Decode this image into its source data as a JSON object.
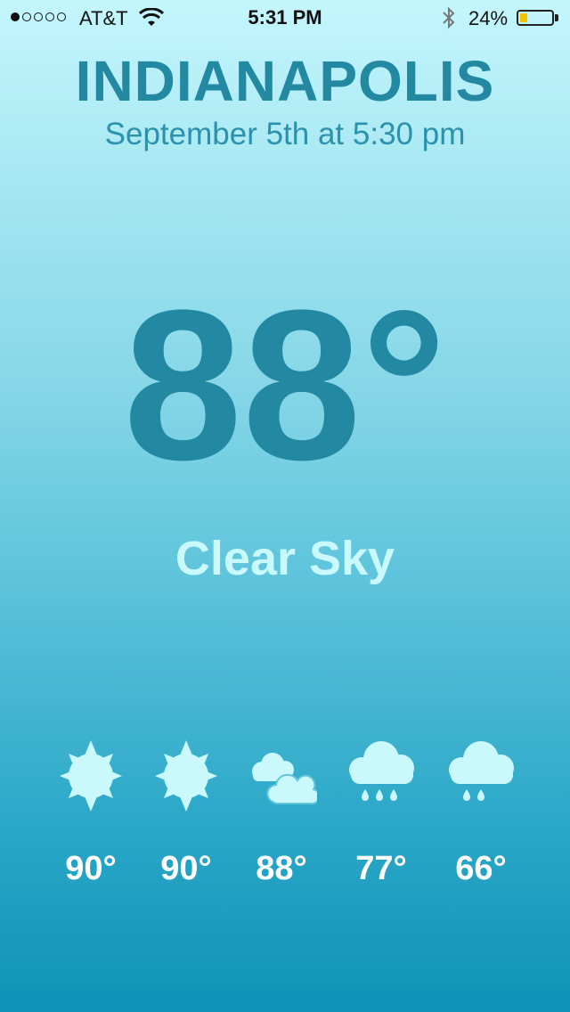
{
  "status_bar": {
    "carrier": "AT&T",
    "time": "5:31 PM",
    "battery_percent": "24%",
    "battery_level": 0.24,
    "signal_bars_filled": 1,
    "signal_bars_total": 5
  },
  "weather": {
    "city": "INDIANAPOLIS",
    "datetime": "September 5th at 5:30 pm",
    "temperature": "88°",
    "condition": "Clear Sky"
  },
  "forecast": [
    {
      "icon": "sun-icon",
      "temp": "90°"
    },
    {
      "icon": "sun-icon",
      "temp": "90°"
    },
    {
      "icon": "clouds-icon",
      "temp": "88°"
    },
    {
      "icon": "rain-cloud-icon",
      "temp": "77°"
    },
    {
      "icon": "rain-cloud-icon",
      "temp": "66°"
    }
  ],
  "colors": {
    "primary_text": "#2388a2",
    "condition_text": "#c9f9fd",
    "icon_fill": "#c9f9fd",
    "forecast_text": "#ffffff",
    "battery_fill": "#f5c400"
  }
}
